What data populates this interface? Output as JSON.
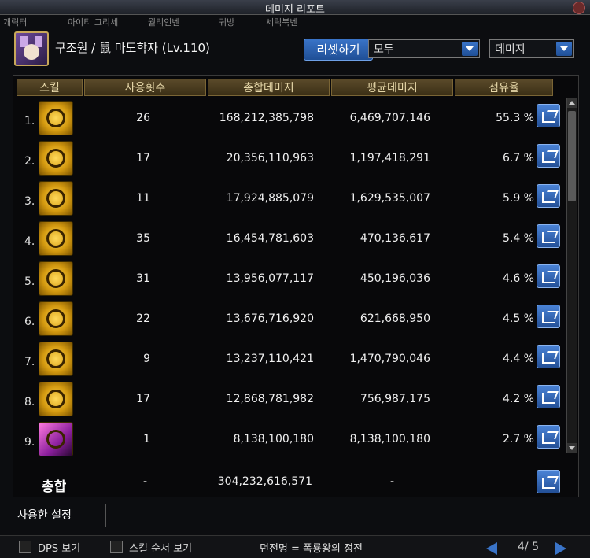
{
  "window": {
    "title": "데미지 리포트"
  },
  "bg_tabs": [
    "개릭터",
    "아이티 그리세",
    "월리인벤",
    "귀방",
    "세릭북벤"
  ],
  "player": {
    "name": "구조원 / 鼠 마도학자 (Lv.110)"
  },
  "controls": {
    "reset_label": "리셋하기",
    "filter_value": "모두",
    "type_value": "데미지"
  },
  "table": {
    "headers": [
      "스킬",
      "사용횟수",
      "총합데미지",
      "평균데미지",
      "점유율"
    ],
    "rows": [
      {
        "rank": "1.",
        "icon": "swirl-skill-icon",
        "uses": "26",
        "total": "168,212,385,798",
        "avg": "6,469,707,146",
        "share": "55.3 %"
      },
      {
        "rank": "2.",
        "icon": "cauldron-skill-icon",
        "uses": "17",
        "total": "20,356,110,963",
        "avg": "1,197,418,291",
        "share": "6.7 %"
      },
      {
        "rank": "3.",
        "icon": "burst-skill-icon",
        "uses": "11",
        "total": "17,924,885,079",
        "avg": "1,629,535,007",
        "share": "5.9 %"
      },
      {
        "rank": "4.",
        "icon": "pumpkin-skill-icon",
        "uses": "35",
        "total": "16,454,781,603",
        "avg": "470,136,617",
        "share": "5.4 %"
      },
      {
        "rank": "5.",
        "icon": "cloud-skill-icon",
        "uses": "31",
        "total": "13,956,077,117",
        "avg": "450,196,036",
        "share": "4.6 %"
      },
      {
        "rank": "6.",
        "icon": "arch-skill-icon",
        "uses": "22",
        "total": "13,676,716,920",
        "avg": "621,668,950",
        "share": "4.5 %"
      },
      {
        "rank": "7.",
        "icon": "creature-skill-icon",
        "uses": "9",
        "total": "13,237,110,421",
        "avg": "1,470,790,046",
        "share": "4.4 %"
      },
      {
        "rank": "8.",
        "icon": "sack-skill-icon",
        "uses": "17",
        "total": "12,868,781,982",
        "avg": "756,987,175",
        "share": "4.2 %"
      },
      {
        "rank": "9.",
        "icon": "purple-skill-icon",
        "uses": "1",
        "total": "8,138,100,180",
        "avg": "8,138,100,180",
        "share": "2.7 %"
      }
    ],
    "total_row": {
      "label": "총합",
      "uses": "-",
      "total": "304,232,616,571",
      "avg": "-"
    }
  },
  "settings_label": "사용한 설정",
  "bottom": {
    "dps_label": "DPS 보기",
    "order_label": "스킬 순서 보기",
    "dungeon": "던전명 = 폭룡왕의 정전",
    "page": "4/ 5"
  },
  "colors": {
    "accent": "#3a74c8",
    "gold": "#d49a10",
    "header": "#5a4a2a"
  }
}
